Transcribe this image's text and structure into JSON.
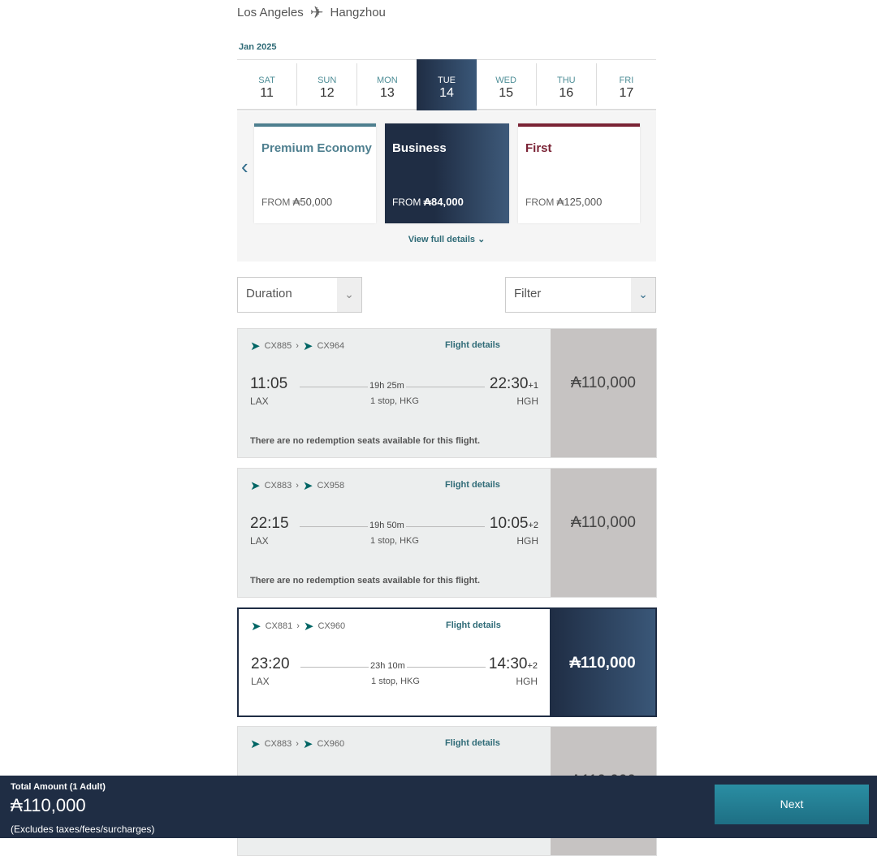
{
  "route": {
    "origin": "Los Angeles",
    "destination": "Hangzhou",
    "icon": "plane-icon"
  },
  "month": "Jan 2025",
  "dates": [
    {
      "dow": "SAT",
      "day": "11"
    },
    {
      "dow": "SUN",
      "day": "12"
    },
    {
      "dow": "MON",
      "day": "13"
    },
    {
      "dow": "TUE",
      "day": "14",
      "selected": true
    },
    {
      "dow": "WED",
      "day": "15"
    },
    {
      "dow": "THU",
      "day": "16"
    },
    {
      "dow": "FRI",
      "day": "17"
    }
  ],
  "cabins": [
    {
      "name": "Premium Economy",
      "from": "FROM",
      "price": "₳50,000",
      "color": "#4e7f8f"
    },
    {
      "name": "Business",
      "from": "FROM",
      "price": "₳84,000",
      "selected": true
    },
    {
      "name": "First",
      "from": "FROM",
      "price": "₳125,000",
      "color": "#7a2335"
    }
  ],
  "view_full_details": "View full details ⌄",
  "sort": {
    "value": "Duration"
  },
  "filter": {
    "value": "Filter"
  },
  "flights": [
    {
      "seg1": "CX885",
      "seg2": "CX964",
      "details": "Flight details",
      "dep": "11:05",
      "dep_ap": "LAX",
      "duration": "19h 25m",
      "stops": "1 stop, HKG",
      "arr": "22:30",
      "arr_off": "+1",
      "arr_ap": "HGH",
      "price": "₳110,000",
      "note": "There are no redemption seats available for this flight."
    },
    {
      "seg1": "CX883",
      "seg2": "CX958",
      "details": "Flight details",
      "dep": "22:15",
      "dep_ap": "LAX",
      "duration": "19h 50m",
      "stops": "1 stop, HKG",
      "arr": "10:05",
      "arr_off": "+2",
      "arr_ap": "HGH",
      "price": "₳110,000",
      "note": "There are no redemption seats available for this flight."
    },
    {
      "seg1": "CX881",
      "seg2": "CX960",
      "details": "Flight details",
      "dep": "23:20",
      "dep_ap": "LAX",
      "duration": "23h 10m",
      "stops": "1 stop, HKG",
      "arr": "14:30",
      "arr_off": "+2",
      "arr_ap": "HGH",
      "price": "₳110,000",
      "selected": true
    },
    {
      "seg1": "CX883",
      "seg2": "CX960",
      "details": "Flight details",
      "price": "₳110,000"
    }
  ],
  "footer": {
    "label": "Total Amount (1 Adult)",
    "amount": "₳110,000",
    "note": "(Excludes taxes/fees/surcharges)",
    "next": "Next"
  }
}
